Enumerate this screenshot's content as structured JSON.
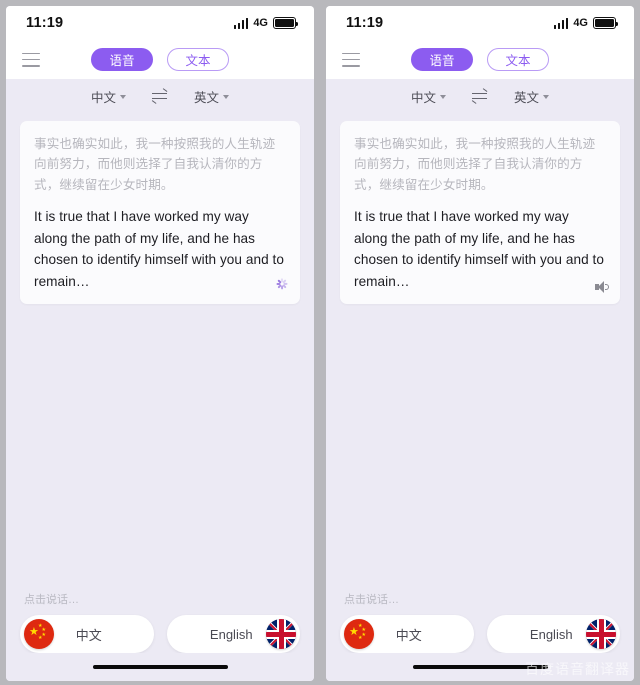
{
  "status_bar": {
    "time": "11:19",
    "network": "4G",
    "signal_icon": "signal-bars-icon",
    "battery_icon": "battery-full-icon"
  },
  "top_bar": {
    "menu_icon": "hamburger-menu-icon",
    "modes": [
      {
        "label": "语音",
        "active": true
      },
      {
        "label": "文本",
        "active": false
      }
    ]
  },
  "language_selector": {
    "source": "中文",
    "target": "英文",
    "swap_icon": "swap-arrows-icon",
    "caret_icon": "chevron-down-icon"
  },
  "conversation": {
    "bubble": {
      "source_text": "事实也确实如此，我一种按照我的人生轨迹向前努力，而他则选择了自我认清你的方式，继续留在少女时期。",
      "translated_text": "It is true that I have worked my way along the path of my life, and he has chosen to identify himself with you and to remain…"
    }
  },
  "panels": [
    {
      "id": "left",
      "trailing_icon": "loading-spinner-icon"
    },
    {
      "id": "right",
      "trailing_icon": "speaker-sound-icon"
    }
  ],
  "bottom": {
    "hint": "点击说话…",
    "buttons": [
      {
        "label": "中文",
        "flag": "china-flag-icon",
        "position": "left"
      },
      {
        "label": "English",
        "flag": "uk-flag-icon",
        "position": "right"
      }
    ],
    "home_indicator": "home-indicator-bar"
  },
  "watermark": {
    "text": "百度语音翻译器"
  },
  "colors": {
    "accent_purple": "#8c5cf6",
    "accent_purple_border": "#b99bf5",
    "page_background": "#eceaf4",
    "card_background": "#fbfbfd",
    "source_text": "#b6b6bd",
    "translated_text": "#1d1d22",
    "flag_red": "#de2910",
    "flag_yellow": "#ffde00",
    "uk_blue": "#012169",
    "uk_red": "#c8102e"
  }
}
